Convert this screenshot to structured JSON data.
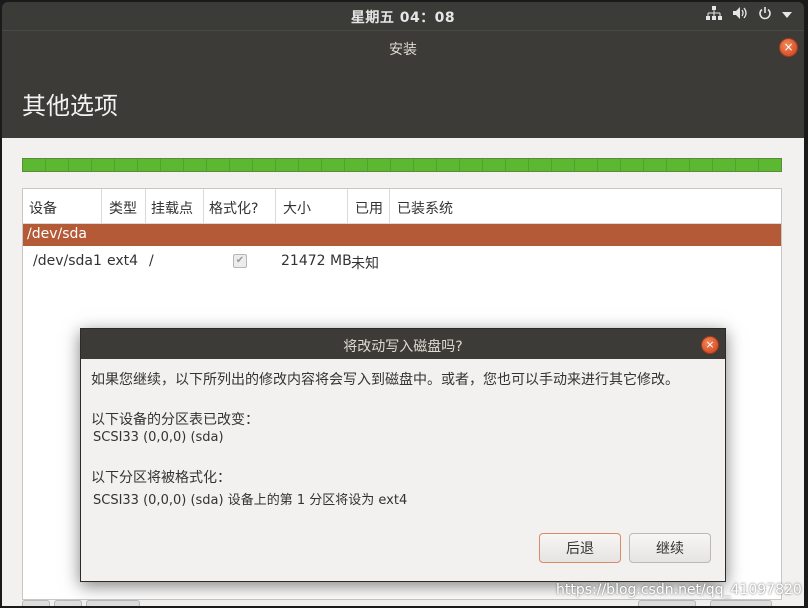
{
  "topbar": {
    "clock": "星期五 04：08",
    "icons": [
      "network-icon",
      "volume-icon",
      "power-icon",
      "menu-down-icon"
    ]
  },
  "window": {
    "title": "安装",
    "close": "×"
  },
  "page": {
    "title": "其他选项"
  },
  "progress": {
    "value": 1.0
  },
  "table": {
    "headers": [
      "设备",
      "类型",
      "挂载点",
      "格式化?",
      "大小",
      "已用",
      "已装系统"
    ],
    "selected_row": "/dev/sda",
    "row": {
      "device": "/dev/sda1",
      "type": "ext4",
      "mount": "/",
      "format": true,
      "size": "21472 MB",
      "used": "未知",
      "system": ""
    }
  },
  "dialog": {
    "title": "将改动写入磁盘吗?",
    "close": "×",
    "intro": "如果您继续，以下所列出的修改内容将会写入到磁盘中。或者，您也可以手动来进行其它修改。",
    "partition_heading": "以下设备的分区表已改变：",
    "partition_device": "SCSI33 (0,0,0) (sda)",
    "format_heading": "以下分区将被格式化：",
    "format_item": "SCSI33 (0,0,0) (sda) 设备上的第 1 分区将设为 ext4",
    "back_label": "后退",
    "continue_label": "继续"
  },
  "watermark": "https://blog.csdn.net/qq_41097820",
  "colors": {
    "accent": "#b45a36",
    "progress": "#5cb830",
    "chrome": "#3c3b37"
  }
}
